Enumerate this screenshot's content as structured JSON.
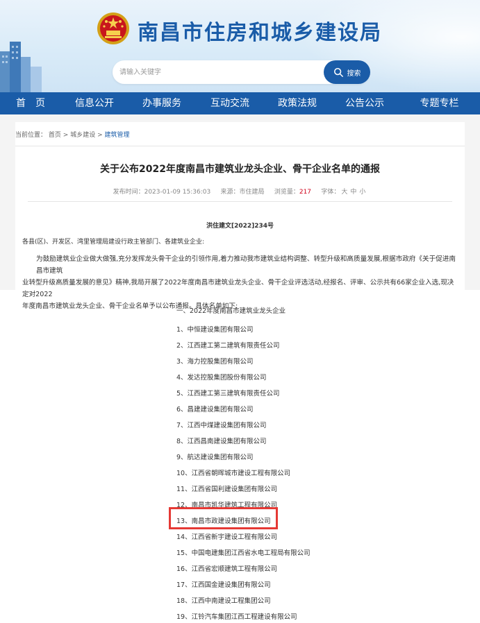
{
  "header": {
    "site_title": "南昌市住房和城乡建设局",
    "search_placeholder": "请输入关键字",
    "search_button": "搜索"
  },
  "nav": {
    "items": [
      "首　页",
      "信息公开",
      "办事服务",
      "互动交流",
      "政策法规",
      "公告公示",
      "专题专栏"
    ]
  },
  "breadcrumb": {
    "prefix": "当前位置：",
    "items": [
      "首页",
      "城乡建设",
      "建筑管理"
    ]
  },
  "article": {
    "title": "关于公布2022年度南昌市建筑业龙头企业、骨干企业名单的通报",
    "meta": {
      "published_label": "发布时间：",
      "published": "2023-01-09 15:36:03",
      "source_label": "来源：",
      "source": "市住建局",
      "views_label": "浏览量：",
      "views": "217",
      "font_label": "字体：",
      "font_sizes": [
        "大",
        "中",
        "小"
      ]
    },
    "doc_number": "洪住建文[2022]234号",
    "salutation": "各县(区)、开发区、湾里管理局建设行政主管部门、各建筑业企业:",
    "paragraph_lines": [
      "为鼓励建筑业企业做大做强,充分发挥龙头骨干企业的引领作用,着力推动我市建筑业结构调整、转型升级和高质量发展,根据市政府《关于促进南昌市建筑",
      "业转型升级高质量发展的意见》精神,我局开展了2022年度南昌市建筑业龙头企业、骨干企业评选活动,经报名、评审、公示共有66家企业入选,现决定对2022",
      "年度南昌市建筑业龙头企业、骨干企业名单予以公布通报。具体名单如下:"
    ],
    "list": [
      "一、2022年度南昌市建筑业龙头企业",
      "1、中恒建设集团有限公司",
      "2、江西建工第二建筑有限责任公司",
      "3、海力控股集团有限公司",
      "4、发达控股集团股份有限公司",
      "5、江西建工第三建筑有限责任公司",
      "6、昌建建设集团有限公司",
      "7、江西中煤建设集团有限公司",
      "8、江西昌南建设集团有限公司",
      "9、航达建设集团有限公司",
      "10、江西省朝晖城市建设工程有限公司",
      "11、江西省国利建设集团有限公司",
      "12、南昌市凯华建筑工程有限公司",
      "13、南昌市政建设集团有限公司",
      "14、江西省新宇建设工程有限公司",
      "15、中国电建集团江西省水电工程局有限公司",
      "16、江西省宏顺建筑工程有限公司",
      "17、江西国金建设集团有限公司",
      "18、江西中南建设工程集团公司",
      "19、江铃汽车集团江西工程建设有限公司"
    ]
  },
  "colors": {
    "brand_blue": "#1a5ca8",
    "highlight_red": "#e53935",
    "views_red": "#d0021b"
  }
}
